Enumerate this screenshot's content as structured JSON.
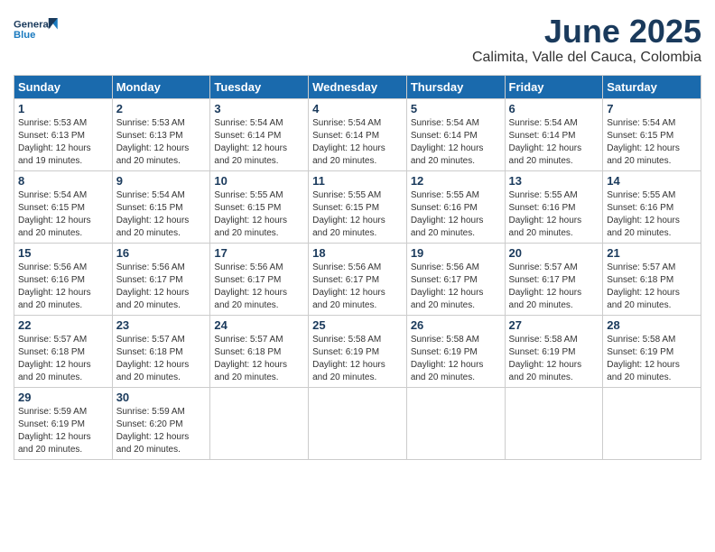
{
  "header": {
    "logo_general": "General",
    "logo_blue": "Blue",
    "month_title": "June 2025",
    "location": "Calimita, Valle del Cauca, Colombia"
  },
  "days_of_week": [
    "Sunday",
    "Monday",
    "Tuesday",
    "Wednesday",
    "Thursday",
    "Friday",
    "Saturday"
  ],
  "weeks": [
    [
      {
        "day": "1",
        "sunrise": "5:53 AM",
        "sunset": "6:13 PM",
        "daylight": "12 hours and 19 minutes."
      },
      {
        "day": "2",
        "sunrise": "5:53 AM",
        "sunset": "6:13 PM",
        "daylight": "12 hours and 20 minutes."
      },
      {
        "day": "3",
        "sunrise": "5:54 AM",
        "sunset": "6:14 PM",
        "daylight": "12 hours and 20 minutes."
      },
      {
        "day": "4",
        "sunrise": "5:54 AM",
        "sunset": "6:14 PM",
        "daylight": "12 hours and 20 minutes."
      },
      {
        "day": "5",
        "sunrise": "5:54 AM",
        "sunset": "6:14 PM",
        "daylight": "12 hours and 20 minutes."
      },
      {
        "day": "6",
        "sunrise": "5:54 AM",
        "sunset": "6:14 PM",
        "daylight": "12 hours and 20 minutes."
      },
      {
        "day": "7",
        "sunrise": "5:54 AM",
        "sunset": "6:15 PM",
        "daylight": "12 hours and 20 minutes."
      }
    ],
    [
      {
        "day": "8",
        "sunrise": "5:54 AM",
        "sunset": "6:15 PM",
        "daylight": "12 hours and 20 minutes."
      },
      {
        "day": "9",
        "sunrise": "5:54 AM",
        "sunset": "6:15 PM",
        "daylight": "12 hours and 20 minutes."
      },
      {
        "day": "10",
        "sunrise": "5:55 AM",
        "sunset": "6:15 PM",
        "daylight": "12 hours and 20 minutes."
      },
      {
        "day": "11",
        "sunrise": "5:55 AM",
        "sunset": "6:15 PM",
        "daylight": "12 hours and 20 minutes."
      },
      {
        "day": "12",
        "sunrise": "5:55 AM",
        "sunset": "6:16 PM",
        "daylight": "12 hours and 20 minutes."
      },
      {
        "day": "13",
        "sunrise": "5:55 AM",
        "sunset": "6:16 PM",
        "daylight": "12 hours and 20 minutes."
      },
      {
        "day": "14",
        "sunrise": "5:55 AM",
        "sunset": "6:16 PM",
        "daylight": "12 hours and 20 minutes."
      }
    ],
    [
      {
        "day": "15",
        "sunrise": "5:56 AM",
        "sunset": "6:16 PM",
        "daylight": "12 hours and 20 minutes."
      },
      {
        "day": "16",
        "sunrise": "5:56 AM",
        "sunset": "6:17 PM",
        "daylight": "12 hours and 20 minutes."
      },
      {
        "day": "17",
        "sunrise": "5:56 AM",
        "sunset": "6:17 PM",
        "daylight": "12 hours and 20 minutes."
      },
      {
        "day": "18",
        "sunrise": "5:56 AM",
        "sunset": "6:17 PM",
        "daylight": "12 hours and 20 minutes."
      },
      {
        "day": "19",
        "sunrise": "5:56 AM",
        "sunset": "6:17 PM",
        "daylight": "12 hours and 20 minutes."
      },
      {
        "day": "20",
        "sunrise": "5:57 AM",
        "sunset": "6:17 PM",
        "daylight": "12 hours and 20 minutes."
      },
      {
        "day": "21",
        "sunrise": "5:57 AM",
        "sunset": "6:18 PM",
        "daylight": "12 hours and 20 minutes."
      }
    ],
    [
      {
        "day": "22",
        "sunrise": "5:57 AM",
        "sunset": "6:18 PM",
        "daylight": "12 hours and 20 minutes."
      },
      {
        "day": "23",
        "sunrise": "5:57 AM",
        "sunset": "6:18 PM",
        "daylight": "12 hours and 20 minutes."
      },
      {
        "day": "24",
        "sunrise": "5:57 AM",
        "sunset": "6:18 PM",
        "daylight": "12 hours and 20 minutes."
      },
      {
        "day": "25",
        "sunrise": "5:58 AM",
        "sunset": "6:19 PM",
        "daylight": "12 hours and 20 minutes."
      },
      {
        "day": "26",
        "sunrise": "5:58 AM",
        "sunset": "6:19 PM",
        "daylight": "12 hours and 20 minutes."
      },
      {
        "day": "27",
        "sunrise": "5:58 AM",
        "sunset": "6:19 PM",
        "daylight": "12 hours and 20 minutes."
      },
      {
        "day": "28",
        "sunrise": "5:58 AM",
        "sunset": "6:19 PM",
        "daylight": "12 hours and 20 minutes."
      }
    ],
    [
      {
        "day": "29",
        "sunrise": "5:59 AM",
        "sunset": "6:19 PM",
        "daylight": "12 hours and 20 minutes."
      },
      {
        "day": "30",
        "sunrise": "5:59 AM",
        "sunset": "6:20 PM",
        "daylight": "12 hours and 20 minutes."
      },
      null,
      null,
      null,
      null,
      null
    ]
  ]
}
